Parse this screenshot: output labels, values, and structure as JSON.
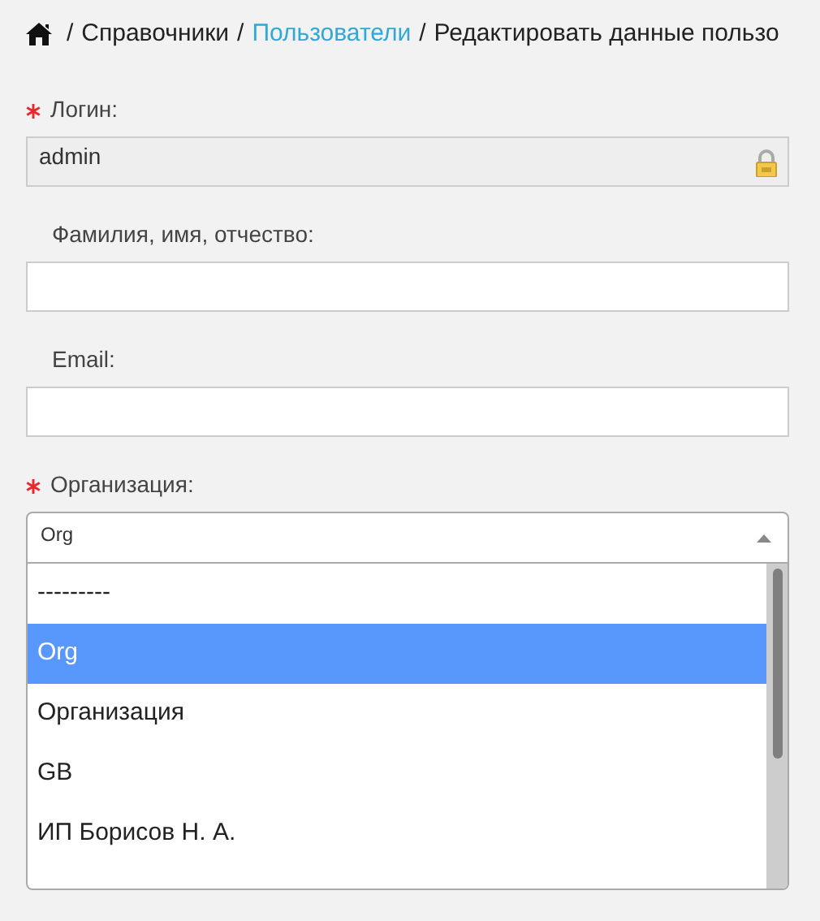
{
  "breadcrumb": {
    "separator": "/",
    "items": [
      {
        "label": "Справочники",
        "link": false
      },
      {
        "label": "Пользователи",
        "link": true
      },
      {
        "label": "Редактировать данные пользо",
        "link": false
      }
    ]
  },
  "fields": [
    {
      "kind": "text",
      "label": "Логин:",
      "required": true,
      "value": "admin",
      "readonly": true
    },
    {
      "kind": "text",
      "label": "Фамилия, имя, отчество:",
      "required": false,
      "readonly": false
    },
    {
      "kind": "text",
      "label": "Email:",
      "required": false,
      "readonly": false
    },
    {
      "kind": "select",
      "label": "Организация:",
      "required": true,
      "value": "Org",
      "expanded": true,
      "options": [
        {
          "label": "---------",
          "selected": false
        },
        {
          "label": "Org",
          "selected": true
        },
        {
          "label": "Организация",
          "selected": false
        },
        {
          "label": "GB",
          "selected": false
        },
        {
          "label": "ИП Борисов Н. А.",
          "selected": false
        }
      ]
    }
  ]
}
